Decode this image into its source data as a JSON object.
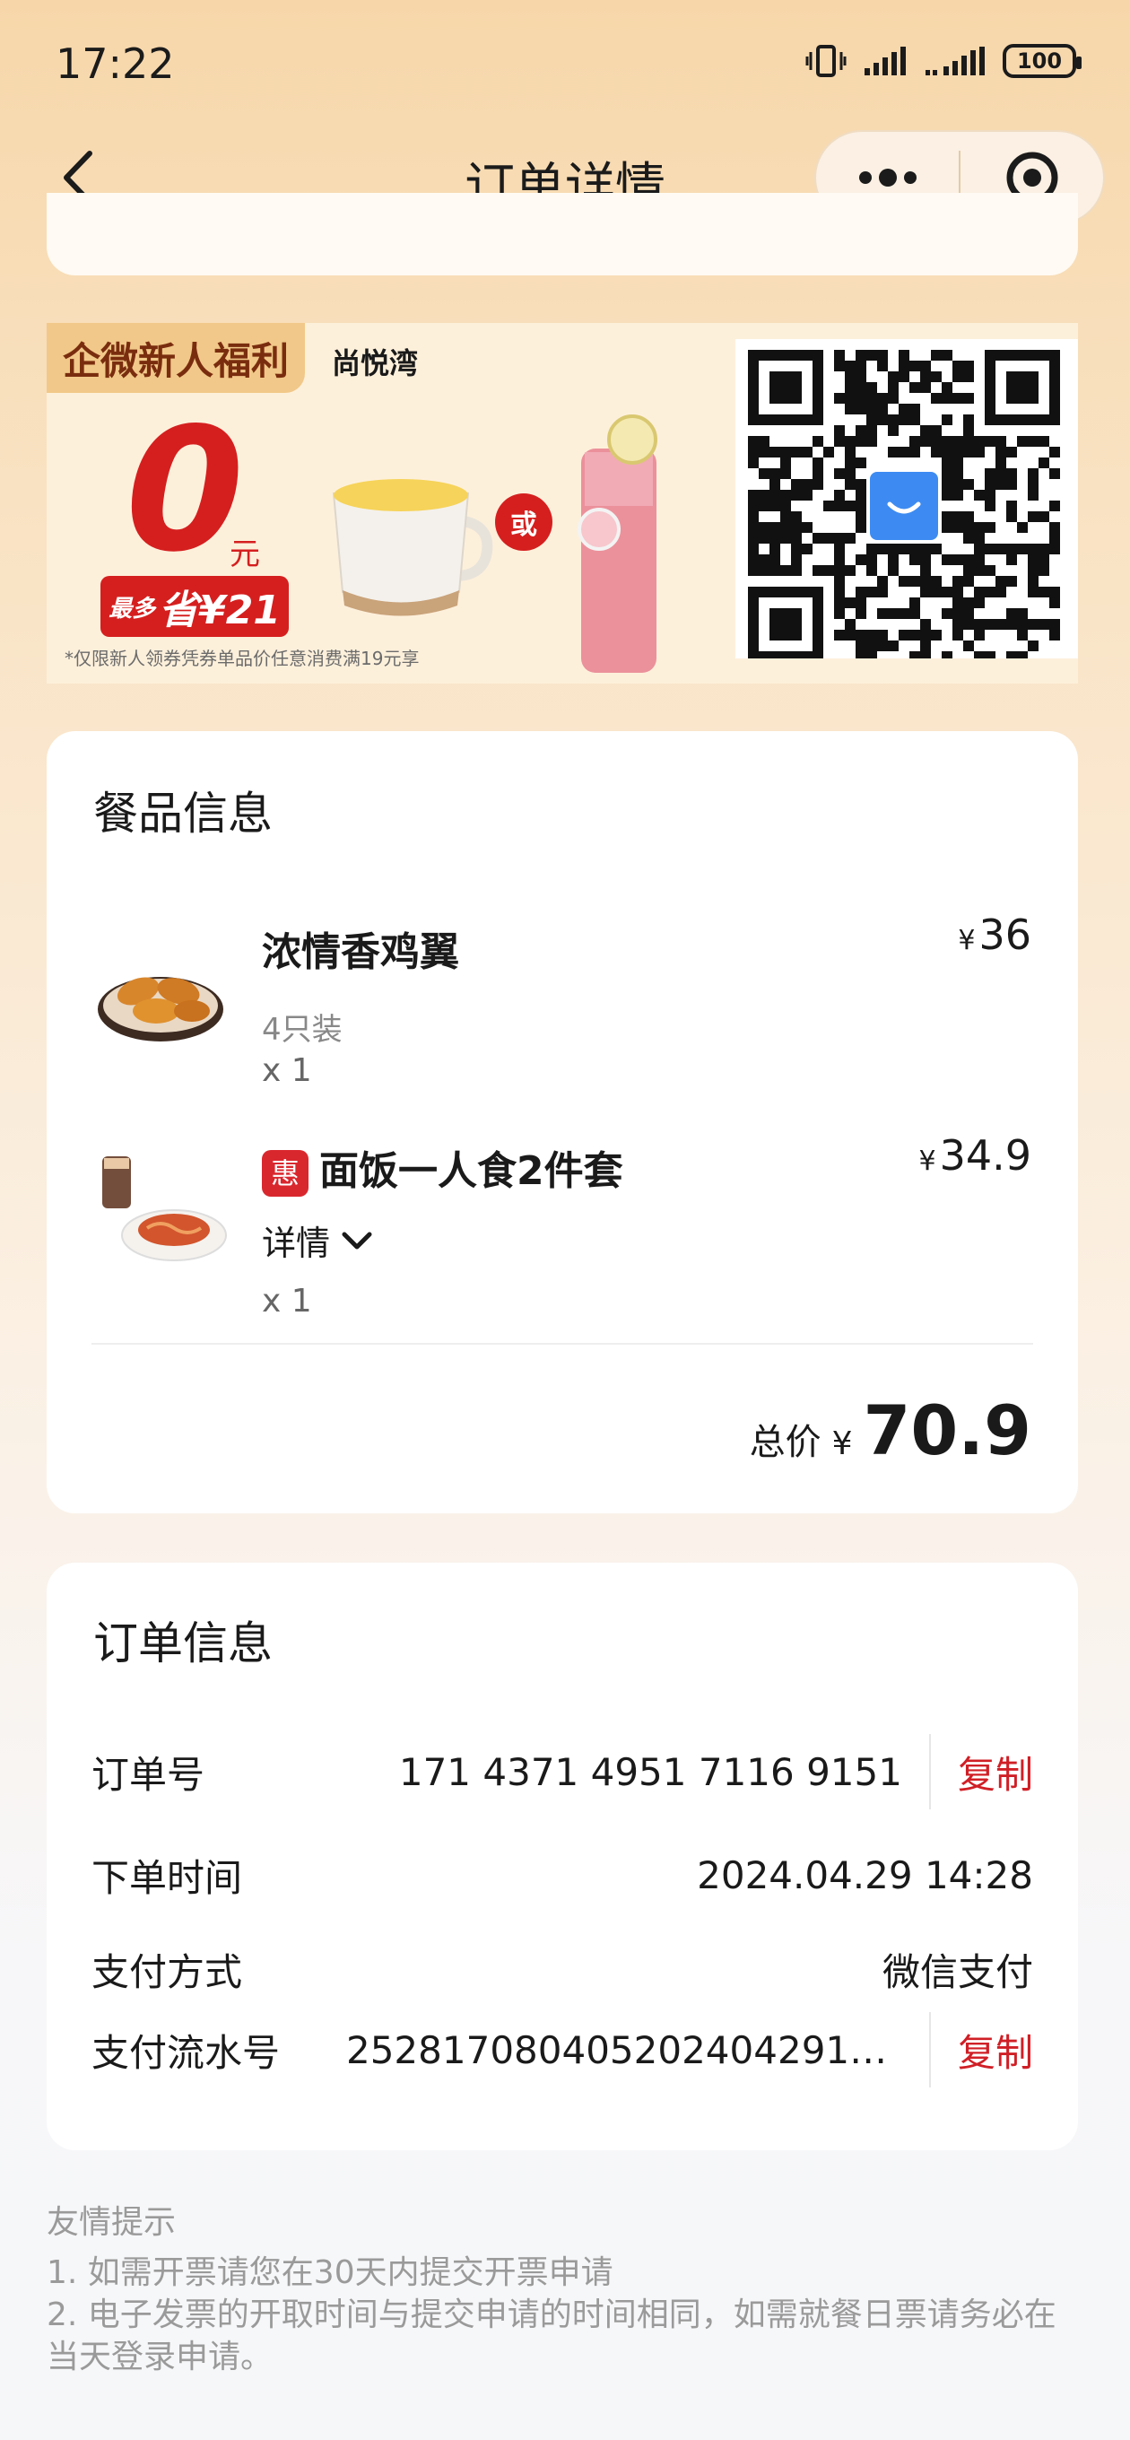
{
  "status_bar": {
    "time": "17:22",
    "battery": "100"
  },
  "nav": {
    "title": "订单详情"
  },
  "banner": {
    "tag": "企微新人福利",
    "location": "尚悦湾",
    "zero": "0",
    "yuan": "元",
    "save_prefix": "最多",
    "save_text": "省¥21",
    "or": "或",
    "note": "*仅限新人领券凭券单品价任意消费满19元享"
  },
  "food_section": {
    "title": "餐品信息",
    "items": [
      {
        "name": "浓情香鸡翼",
        "sub": "4只装",
        "qty": "x 1",
        "currency": "¥",
        "price": "36"
      },
      {
        "badge": "惠",
        "name": "面饭一人食2件套",
        "details_label": "详情",
        "qty": "x 1",
        "currency": "¥",
        "price": "34.9"
      }
    ],
    "total_label": "总价",
    "total_currency": "¥",
    "total_amount": "70.9"
  },
  "order_section": {
    "title": "订单信息",
    "rows": [
      {
        "label": "订单号",
        "value": "171 4371 4951 7116 9151",
        "action": "复制"
      },
      {
        "label": "下单时间",
        "value": "2024.04.29 14:28"
      },
      {
        "label": "支付方式",
        "value": "微信支付"
      },
      {
        "label": "支付流水号",
        "value": "2528170804052024042917…",
        "action": "复制"
      }
    ]
  },
  "tips": {
    "title": "友情提示",
    "line1": "1. 如需开票请您在30天内提交开票申请",
    "line2": "2. 电子发票的开取时间与提交申请的时间相同，如需就餐日票请务必在当天登录申请。"
  },
  "colors": {
    "accent_red": "#d01f26",
    "page_top": "#f7d7aa",
    "card": "#ffffff"
  },
  "icons": [
    "back-arrow-icon",
    "more-dots-icon",
    "target-circle-icon",
    "vibrate-icon",
    "signal-icon",
    "battery-icon",
    "chevron-down-icon",
    "qr-code-icon"
  ]
}
